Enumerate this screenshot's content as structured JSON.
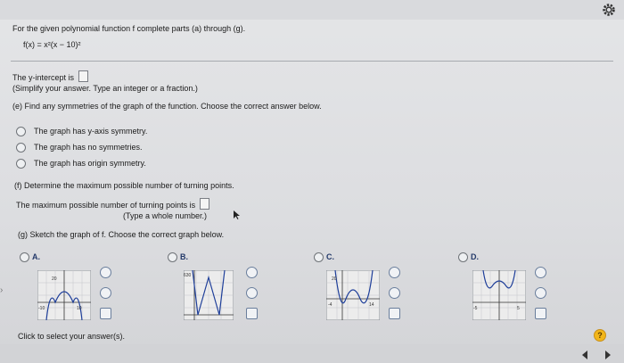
{
  "header": {
    "instruction": "For the given polynomial function f complete parts (a) through (g).",
    "function": "f(x) = x²(x − 10)²"
  },
  "part_y": {
    "prompt": "The y-intercept is",
    "hint": "(Simplify your answer. Type an integer or a fraction.)"
  },
  "part_e": {
    "question": "(e) Find any symmetries of the graph of the function. Choose the correct answer below.",
    "options": [
      "The graph has y-axis symmetry.",
      "The graph has no symmetries.",
      "The graph has origin symmetry."
    ]
  },
  "part_f": {
    "question": "(f) Determine the maximum possible number of turning points.",
    "prompt": "The maximum possible number of turning points is",
    "hint": "(Type a whole number.)"
  },
  "part_g": {
    "question": "(g) Sketch the graph of f. Choose the correct graph below.",
    "options": [
      {
        "label": "A.",
        "tick_x1": "-10",
        "tick_x2": "10",
        "tick_y": "20"
      },
      {
        "label": "B.",
        "tick_y": "630"
      },
      {
        "label": "C.",
        "tick_x1": "-4",
        "tick_x2": "14",
        "tick_y": "20"
      },
      {
        "label": "D.",
        "tick_x1": "-5",
        "tick_x2": "5"
      }
    ]
  },
  "footer": {
    "status": "Click to select your answer(s).",
    "help": "?"
  },
  "colors": {
    "accent": "#243a6a",
    "help": "#f2b61a"
  }
}
